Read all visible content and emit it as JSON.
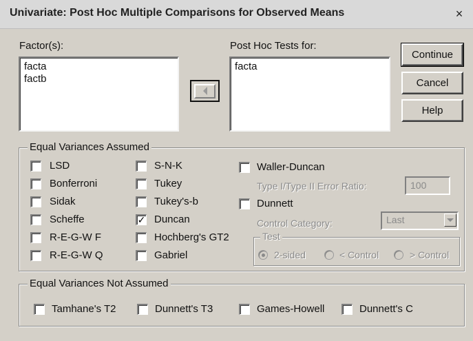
{
  "window": {
    "title": "Univariate: Post Hoc Multiple Comparisons for Observed Means",
    "close_label": "×"
  },
  "factors": {
    "label": "Factor(s):",
    "items": [
      "facta",
      "factb"
    ]
  },
  "post_hoc": {
    "label": "Post Hoc Tests for:",
    "items": [
      "facta"
    ]
  },
  "buttons": {
    "continue": "Continue",
    "cancel": "Cancel",
    "help": "Help"
  },
  "equal_variances_assumed": {
    "caption": "Equal Variances Assumed",
    "tests": [
      {
        "label": "LSD",
        "checked": false
      },
      {
        "label": "Bonferroni",
        "checked": false
      },
      {
        "label": "Sidak",
        "checked": false
      },
      {
        "label": "Scheffe",
        "checked": false
      },
      {
        "label": "R-E-G-W F",
        "checked": false
      },
      {
        "label": "R-E-G-W Q",
        "checked": false
      },
      {
        "label": "S-N-K",
        "checked": false
      },
      {
        "label": "Tukey",
        "checked": false
      },
      {
        "label": "Tukey's-b",
        "checked": false
      },
      {
        "label": "Duncan",
        "checked": true
      },
      {
        "label": "Hochberg's GT2",
        "checked": false
      },
      {
        "label": "Gabriel",
        "checked": false
      }
    ],
    "waller_duncan": {
      "label": "Waller-Duncan",
      "checked": false,
      "ratio_label": "Type I/Type II Error Ratio:",
      "ratio_value": "100"
    },
    "dunnett": {
      "label": "Dunnett",
      "checked": false,
      "control_label": "Control Category:",
      "control_value": "Last"
    },
    "test": {
      "caption": "Test",
      "options": [
        {
          "label": "2-sided",
          "selected": true
        },
        {
          "label": "< Control",
          "selected": false
        },
        {
          "label": "> Control",
          "selected": false
        }
      ]
    }
  },
  "equal_variances_not_assumed": {
    "caption": "Equal Variances Not Assumed",
    "tests": [
      {
        "label": "Tamhane's T2",
        "checked": false
      },
      {
        "label": "Dunnett's T3",
        "checked": false
      },
      {
        "label": "Games-Howell",
        "checked": false
      },
      {
        "label": "Dunnett's C",
        "checked": false
      }
    ]
  }
}
